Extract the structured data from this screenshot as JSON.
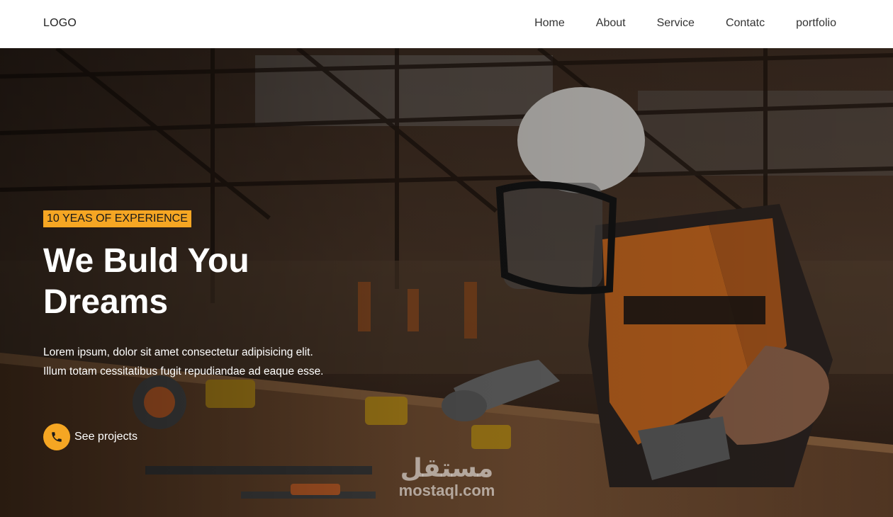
{
  "header": {
    "logo": "LOGO",
    "nav": [
      "Home",
      "About",
      "Service",
      "Contatc",
      "portfolio"
    ]
  },
  "hero": {
    "badge": "10 YEAS OF EXPERIENCE",
    "headline_line1": "We Buld You",
    "headline_line2": "Dreams",
    "lead": "Lorem ipsum, dolor sit amet consectetur adipisicing elit. Illum totam cessitatibus fugit repudiandae ad eaque esse.",
    "cta_label": "See projects",
    "cta_icon": "phone-icon"
  },
  "watermark": {
    "arabic": "مستقل",
    "latin": "mostaql.com"
  },
  "colors": {
    "accent": "#f5a623",
    "header_bg": "#ffffff",
    "hero_text": "#ffffff"
  }
}
